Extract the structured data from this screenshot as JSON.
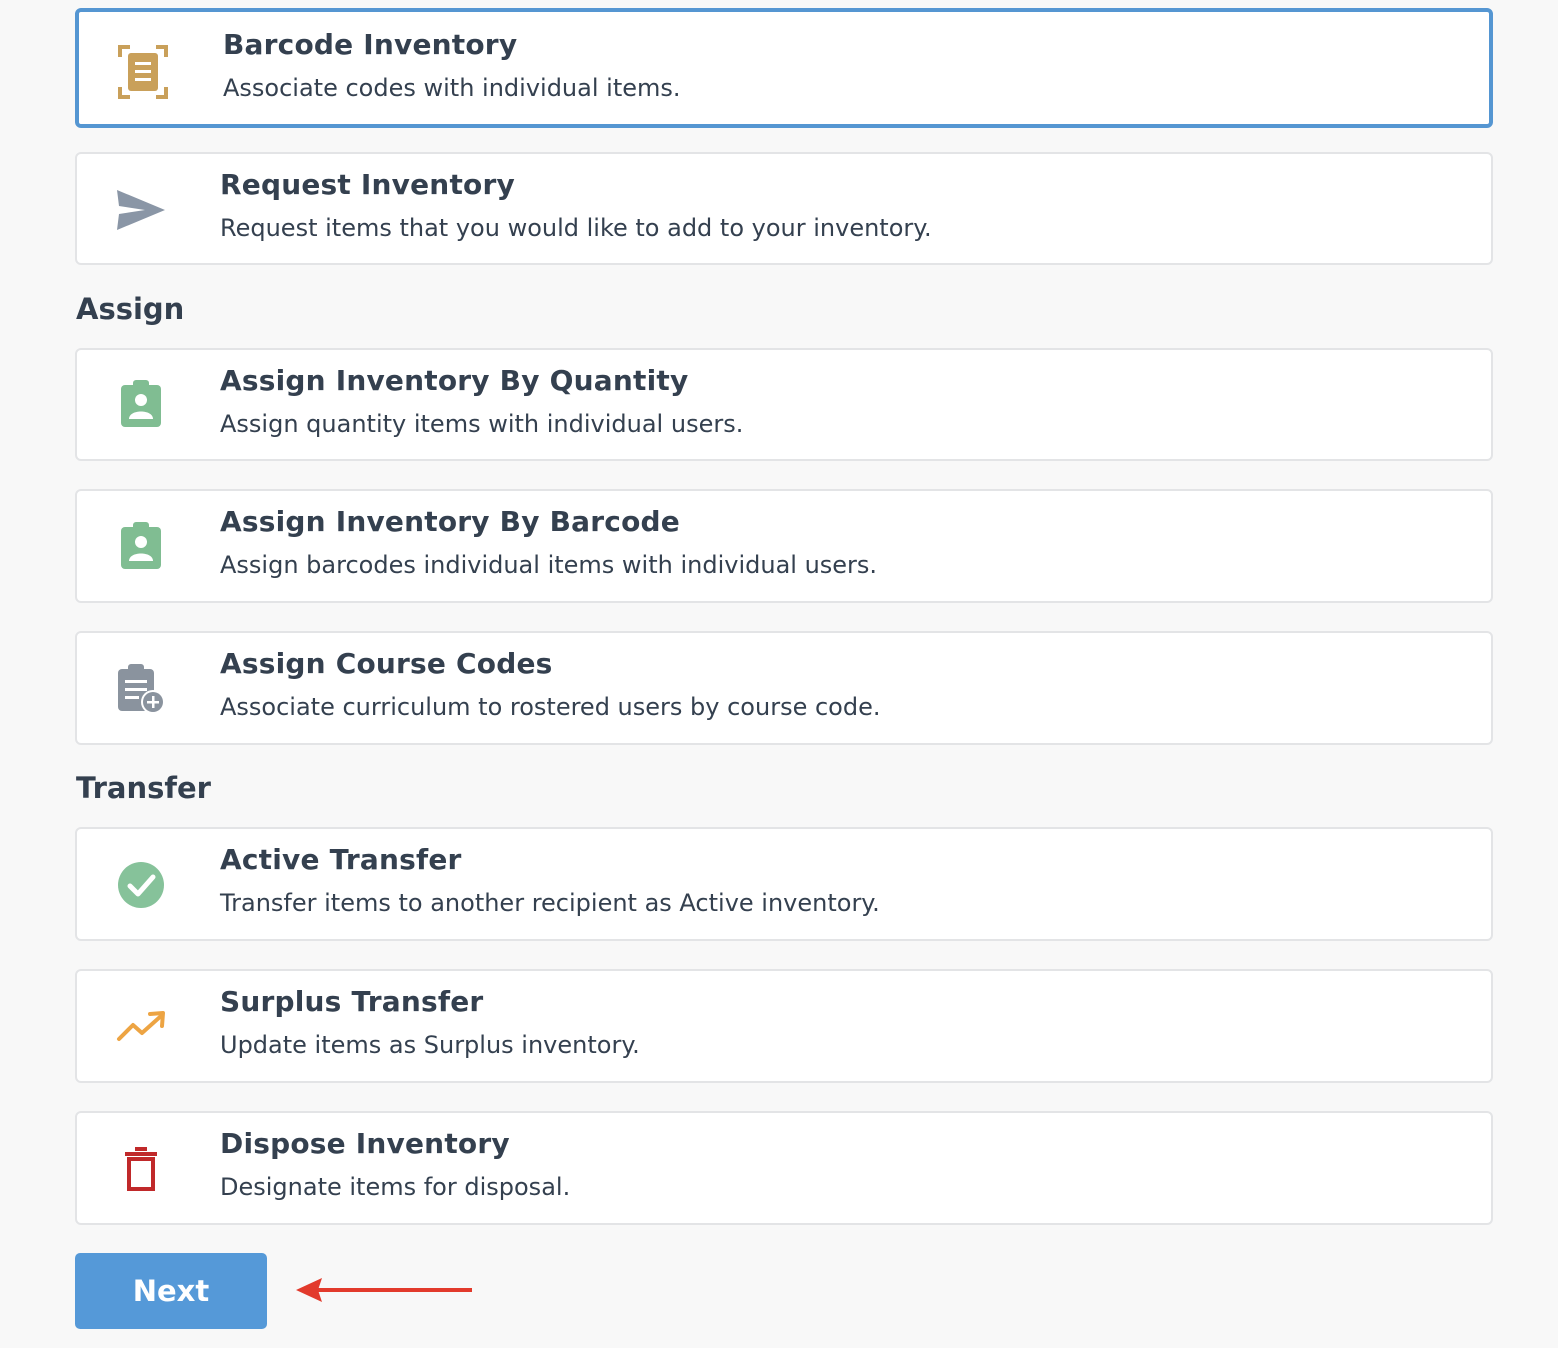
{
  "options": [
    {
      "title": "Barcode Inventory",
      "description": "Associate codes with individual items.",
      "icon": "barcode-scan-icon",
      "selected": true
    },
    {
      "title": "Request Inventory",
      "description": "Request items that you would like to add to your inventory.",
      "icon": "paper-plane-icon"
    },
    {
      "title": "Assign Inventory By Quantity",
      "description": "Assign quantity items with individual users.",
      "icon": "clipboard-user-icon"
    },
    {
      "title": "Assign Inventory By Barcode",
      "description": "Assign barcodes individual items with individual users.",
      "icon": "clipboard-user-icon"
    },
    {
      "title": "Assign Course Codes",
      "description": "Associate curriculum to rostered users by course code.",
      "icon": "clipboard-add-icon"
    },
    {
      "title": "Active Transfer",
      "description": "Transfer items to another recipient as Active inventory.",
      "icon": "check-circle-icon"
    },
    {
      "title": "Surplus Transfer",
      "description": "Update items as Surplus inventory.",
      "icon": "trending-up-icon"
    },
    {
      "title": "Dispose Inventory",
      "description": "Designate items for disposal.",
      "icon": "trash-icon"
    }
  ],
  "sections": {
    "assign": "Assign",
    "transfer": "Transfer"
  },
  "next_button": "Next",
  "colors": {
    "selected_border": "#5596d2",
    "button_bg": "#5599d8",
    "barcode_icon": "#c9a05a",
    "send_icon": "#8a96a6",
    "assign_icon": "#80bd92",
    "course_icon": "#8a939e",
    "check_icon": "#86c29a",
    "surplus_icon": "#eda443",
    "trash_icon": "#c0292a",
    "annotation_arrow": "#e23a2c"
  }
}
